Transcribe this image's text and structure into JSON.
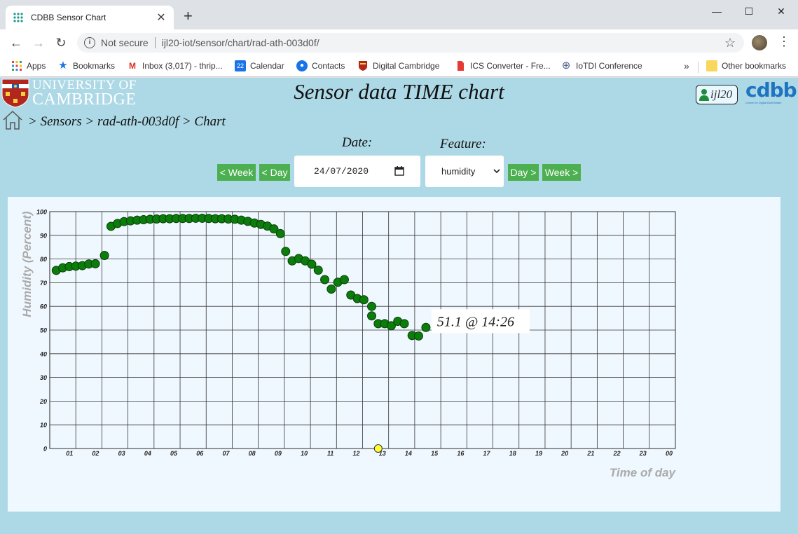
{
  "browser": {
    "tab_title": "CDBB Sensor Chart",
    "security_label": "Not secure",
    "url": "ijl20-iot/sensor/chart/rad-ath-003d0f/",
    "bookmarks": [
      {
        "label": "Apps",
        "icon": "apps-grid-icon"
      },
      {
        "label": "Bookmarks",
        "icon": "star-icon"
      },
      {
        "label": "Inbox (3,017) - thrip...",
        "icon": "gmail-icon"
      },
      {
        "label": "Calendar",
        "icon": "calendar-icon"
      },
      {
        "label": "Contacts",
        "icon": "contacts-icon"
      },
      {
        "label": "Digital Cambridge",
        "icon": "cambridge-shield-icon"
      },
      {
        "label": "ICS Converter - Fre...",
        "icon": "document-icon"
      },
      {
        "label": "IoTDI Conference",
        "icon": "globe-icon"
      }
    ],
    "other_bookmarks": "Other bookmarks"
  },
  "header": {
    "uni_line1": "UNIVERSITY OF",
    "uni_line2": "CAMBRIDGE",
    "title": "Sensor data TIME chart",
    "user": "ijl20",
    "cdbb_logo": "cdbb",
    "cdbb_subtitle": "Centre for Digital Built Britain"
  },
  "breadcrumb": "> Sensors > rad-ath-003d0f > Chart",
  "controls": {
    "date_label": "Date:",
    "feature_label": "Feature:",
    "week_prev": "< Week",
    "day_prev": "< Day",
    "day_next": "Day >",
    "week_next": "Week >",
    "date_value": "24/07/2020",
    "feature_value": "humidity"
  },
  "colors": {
    "page_bg": "#add8e6",
    "chart_bg": "#f0f8ff",
    "button_green": "#4caf50",
    "point_green": "#0a7d0a",
    "marker_yellow": "#ffff33"
  },
  "chart_data": {
    "type": "scatter",
    "ylabel": "Humidity (Percent)",
    "xlabel": "Time of day",
    "ylim": [
      0,
      100
    ],
    "xlim": [
      0,
      24
    ],
    "x_unit": "hours",
    "y_ticks": [
      0,
      10,
      20,
      30,
      40,
      50,
      60,
      70,
      80,
      90,
      100
    ],
    "x_tick_labels": [
      "01",
      "02",
      "03",
      "04",
      "05",
      "06",
      "07",
      "08",
      "09",
      "10",
      "11",
      "12",
      "13",
      "14",
      "15",
      "16",
      "17",
      "18",
      "19",
      "20",
      "21",
      "22",
      "23",
      "00"
    ],
    "grid": true,
    "tooltip": "51.1 @ 14:26",
    "marker_time": 12.6,
    "series": [
      {
        "points": [
          [
            0.25,
            75.2
          ],
          [
            0.5,
            76.3
          ],
          [
            0.75,
            76.8
          ],
          [
            1.0,
            77.0
          ],
          [
            1.25,
            77.2
          ],
          [
            1.5,
            77.9
          ],
          [
            1.75,
            78.0
          ],
          [
            2.1,
            81.5
          ],
          [
            2.35,
            93.8
          ],
          [
            2.6,
            95.0
          ],
          [
            2.85,
            95.8
          ],
          [
            3.1,
            96.1
          ],
          [
            3.35,
            96.4
          ],
          [
            3.6,
            96.6
          ],
          [
            3.85,
            96.8
          ],
          [
            4.1,
            96.9
          ],
          [
            4.35,
            97.0
          ],
          [
            4.6,
            97.0
          ],
          [
            4.85,
            97.1
          ],
          [
            5.1,
            97.1
          ],
          [
            5.35,
            97.1
          ],
          [
            5.6,
            97.2
          ],
          [
            5.85,
            97.2
          ],
          [
            6.1,
            97.1
          ],
          [
            6.35,
            97.0
          ],
          [
            6.6,
            97.0
          ],
          [
            6.85,
            96.9
          ],
          [
            7.1,
            96.8
          ],
          [
            7.35,
            96.4
          ],
          [
            7.6,
            95.9
          ],
          [
            7.85,
            95.2
          ],
          [
            8.1,
            94.6
          ],
          [
            8.35,
            93.9
          ],
          [
            8.6,
            92.7
          ],
          [
            8.85,
            90.7
          ],
          [
            9.05,
            83.2
          ],
          [
            9.3,
            79.2
          ],
          [
            9.55,
            80.2
          ],
          [
            9.8,
            79.2
          ],
          [
            10.05,
            77.8
          ],
          [
            10.3,
            75.3
          ],
          [
            10.55,
            71.3
          ],
          [
            10.8,
            67.3
          ],
          [
            11.05,
            70.2
          ],
          [
            11.3,
            71.3
          ],
          [
            11.55,
            64.8
          ],
          [
            11.8,
            63.3
          ],
          [
            12.05,
            62.8
          ],
          [
            12.35,
            60.0
          ],
          [
            12.35,
            56.0
          ],
          [
            12.6,
            52.7
          ],
          [
            12.85,
            52.7
          ],
          [
            13.1,
            51.8
          ],
          [
            13.35,
            53.7
          ],
          [
            13.6,
            52.7
          ],
          [
            13.9,
            47.7
          ],
          [
            14.15,
            47.5
          ],
          [
            14.43,
            51.1
          ]
        ]
      }
    ]
  }
}
